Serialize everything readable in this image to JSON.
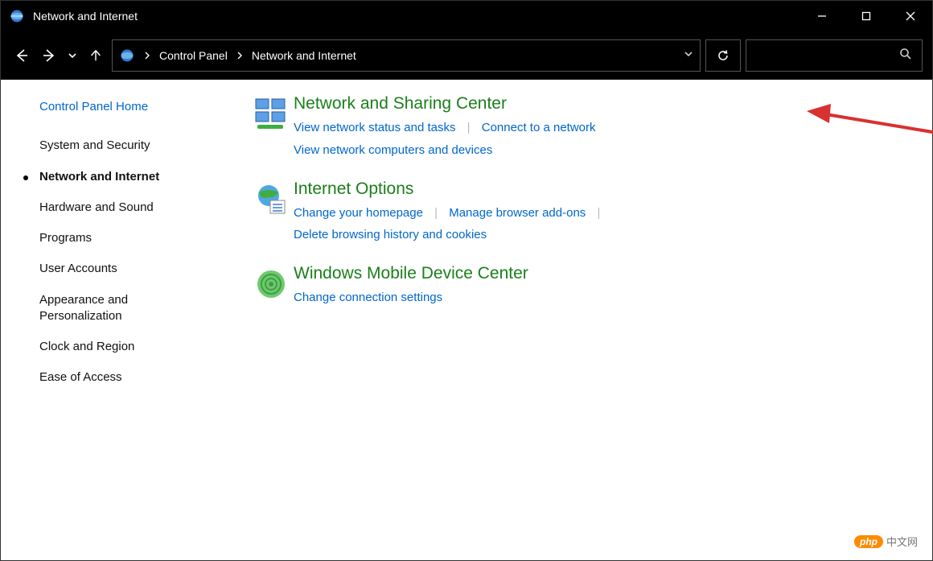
{
  "window": {
    "title": "Network and Internet"
  },
  "breadcrumb": {
    "root": "Control Panel",
    "current": "Network and Internet"
  },
  "sidebar": {
    "home": "Control Panel Home",
    "items": [
      "System and Security",
      "Network and Internet",
      "Hardware and Sound",
      "Programs",
      "User Accounts",
      "Appearance and Personalization",
      "Clock and Region",
      "Ease of Access"
    ],
    "active_index": 1
  },
  "sections": [
    {
      "title": "Network and Sharing Center",
      "links_row1": [
        "View network status and tasks",
        "Connect to a network"
      ],
      "links_row2": [
        "View network computers and devices"
      ]
    },
    {
      "title": "Internet Options",
      "links_row1": [
        "Change your homepage",
        "Manage browser add-ons"
      ],
      "links_row2": [
        "Delete browsing history and cookies"
      ]
    },
    {
      "title": "Windows Mobile Device Center",
      "links_row1": [
        "Change connection settings"
      ],
      "links_row2": []
    }
  ],
  "watermark": {
    "badge": "php",
    "text": "中文网"
  }
}
